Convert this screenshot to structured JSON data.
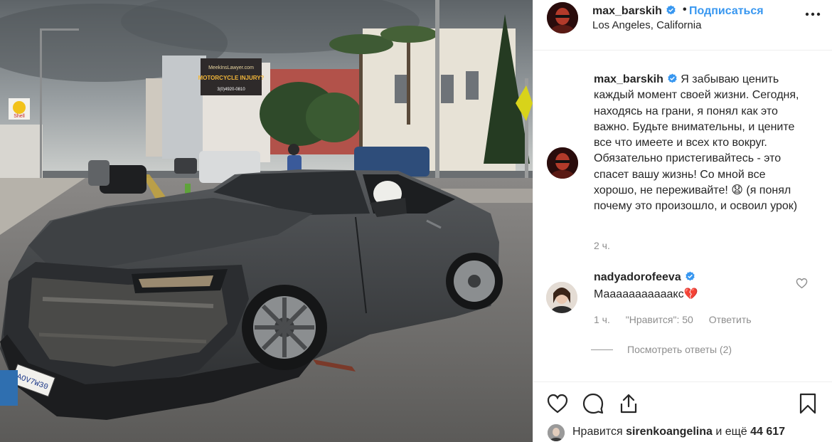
{
  "header": {
    "username": "max_barskih",
    "separator": "•",
    "follow_label": "Подписаться",
    "location": "Los Angeles, California"
  },
  "caption": {
    "username": "max_barskih",
    "text": "Я забываю ценить каждый момент своей жизни. Сегодня, находясь на грани, я понял как это важно. Будьте внимательны, и цените все что имеете и всех кто вокруг. Обязательно пристегивайтесь - это спасет вашу жизнь! Со мной все хорошо, не переживайте! 😧 (я понял почему это произошло, и освоил урок)",
    "time": "2 ч."
  },
  "comment": {
    "username": "nadyadorofeeva",
    "text": "Мааааааааааакс💔",
    "time": "1 ч.",
    "likes_label": "\"Нравится\": 50",
    "reply_label": "Ответить",
    "view_replies_label": "Посмотреть ответы (2)"
  },
  "actions": {
    "icons": [
      "heart-icon",
      "comment-icon",
      "share-icon",
      "bookmark-icon"
    ]
  },
  "likes": {
    "prefix": "Нравится",
    "user": "sirenkoangelina",
    "middle": "и ещё",
    "count": "44 617"
  },
  "photo_signs": {
    "billboard_top": "MeekInsLawyer.com",
    "billboard_main": "MOTORCYCLE INJURY?",
    "billboard_phone": "3(0)4920-0810",
    "plate": "AOV7W30",
    "shell": "Shell"
  },
  "colors": {
    "accent": "#3897f0",
    "verified": "#3897f0",
    "muted": "#8e8e8e",
    "text": "#262626"
  }
}
